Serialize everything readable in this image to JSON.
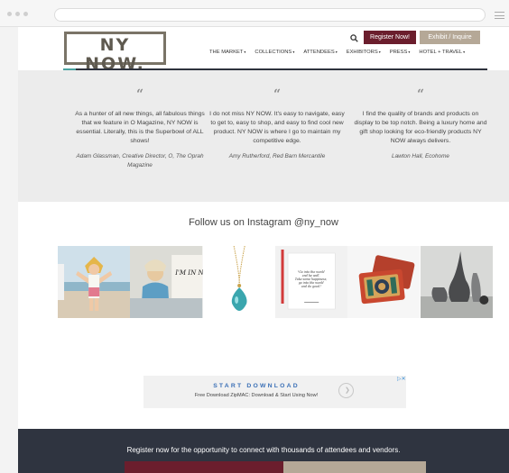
{
  "header": {
    "logo_main": "NY NOW.",
    "logo_sub": "THE MARKET FOR HOME, LIFESTYLE + GIFT",
    "register_label": "Register Now!",
    "exhibit_label": "Exhibit / Inquire",
    "nav": [
      "THE MARKET",
      "COLLECTIONS",
      "ATTENDEES",
      "EXHIBITORS",
      "PRESS",
      "HOTEL + TRAVEL"
    ]
  },
  "testimonials": [
    {
      "icon": "“",
      "text": "As a hunter of all new things, all fabulous things that we feature in O Magazine, NY NOW is essential. Literally, this is the Superbowl of ALL shows!",
      "author": "Adam Glassman, Creative Director, O, The Oprah Magazine"
    },
    {
      "icon": "“",
      "text": "I do not miss NY NOW. It's easy to navigate, easy to get to, easy to shop, and easy to find cool new product. NY NOW is where I go to maintain my competitive edge.",
      "author": "Amy Rutherford, Red Barn Mercantile"
    },
    {
      "icon": "“",
      "text": "I find the quality of brands and products on display to be top notch. Being a luxury home and gift shop looking for eco-friendly products NY NOW always delivers.",
      "author": "Lawton Hall, Ecohome"
    }
  ],
  "instagram": {
    "title": "Follow us on Instagram @ny_now",
    "tile2_text": "I'M IN NY NOW",
    "tile4_text": "\"Go into the world and be well. Take some happiness, go into the world and do good.\""
  },
  "ad": {
    "title": "START DOWNLOAD",
    "subtitle": "Free Download ZipMAC: Download & Start Using Now!",
    "close": "▷✕"
  },
  "footer": {
    "text": "Register now for the opportunity to connect with thousands of attendees and vendors."
  },
  "colors": {
    "brand_maroon": "#6b1e2d",
    "brand_taupe": "#b5a897",
    "footer_bg": "#2f3440",
    "ad_blue": "#3b70b6"
  }
}
